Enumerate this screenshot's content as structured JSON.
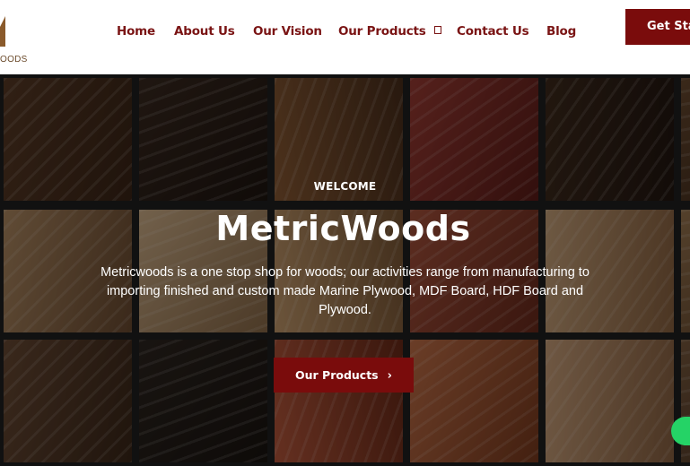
{
  "logo": {
    "text": "OODS"
  },
  "nav": {
    "items": [
      {
        "label": "Home"
      },
      {
        "label": "About Us"
      },
      {
        "label": "Our Vision"
      },
      {
        "label": "Our Products"
      },
      {
        "label": "Contact Us"
      },
      {
        "label": "Blog"
      }
    ],
    "cta_label": "Get Sta"
  },
  "hero": {
    "welcome": "WELCOME",
    "title": "MetricWoods",
    "description": "Metricwoods is a one stop shop for woods; our activities range from manufacturing to importing finished and custom made Marine Plywood, MDF Board, HDF Board and Plywood.",
    "button_label": "Our Products",
    "button_icon": "chevron-right-icon"
  },
  "colors": {
    "brand": "#7a0c0c",
    "nav_text": "#7a1414",
    "whatsapp": "#25d366"
  }
}
